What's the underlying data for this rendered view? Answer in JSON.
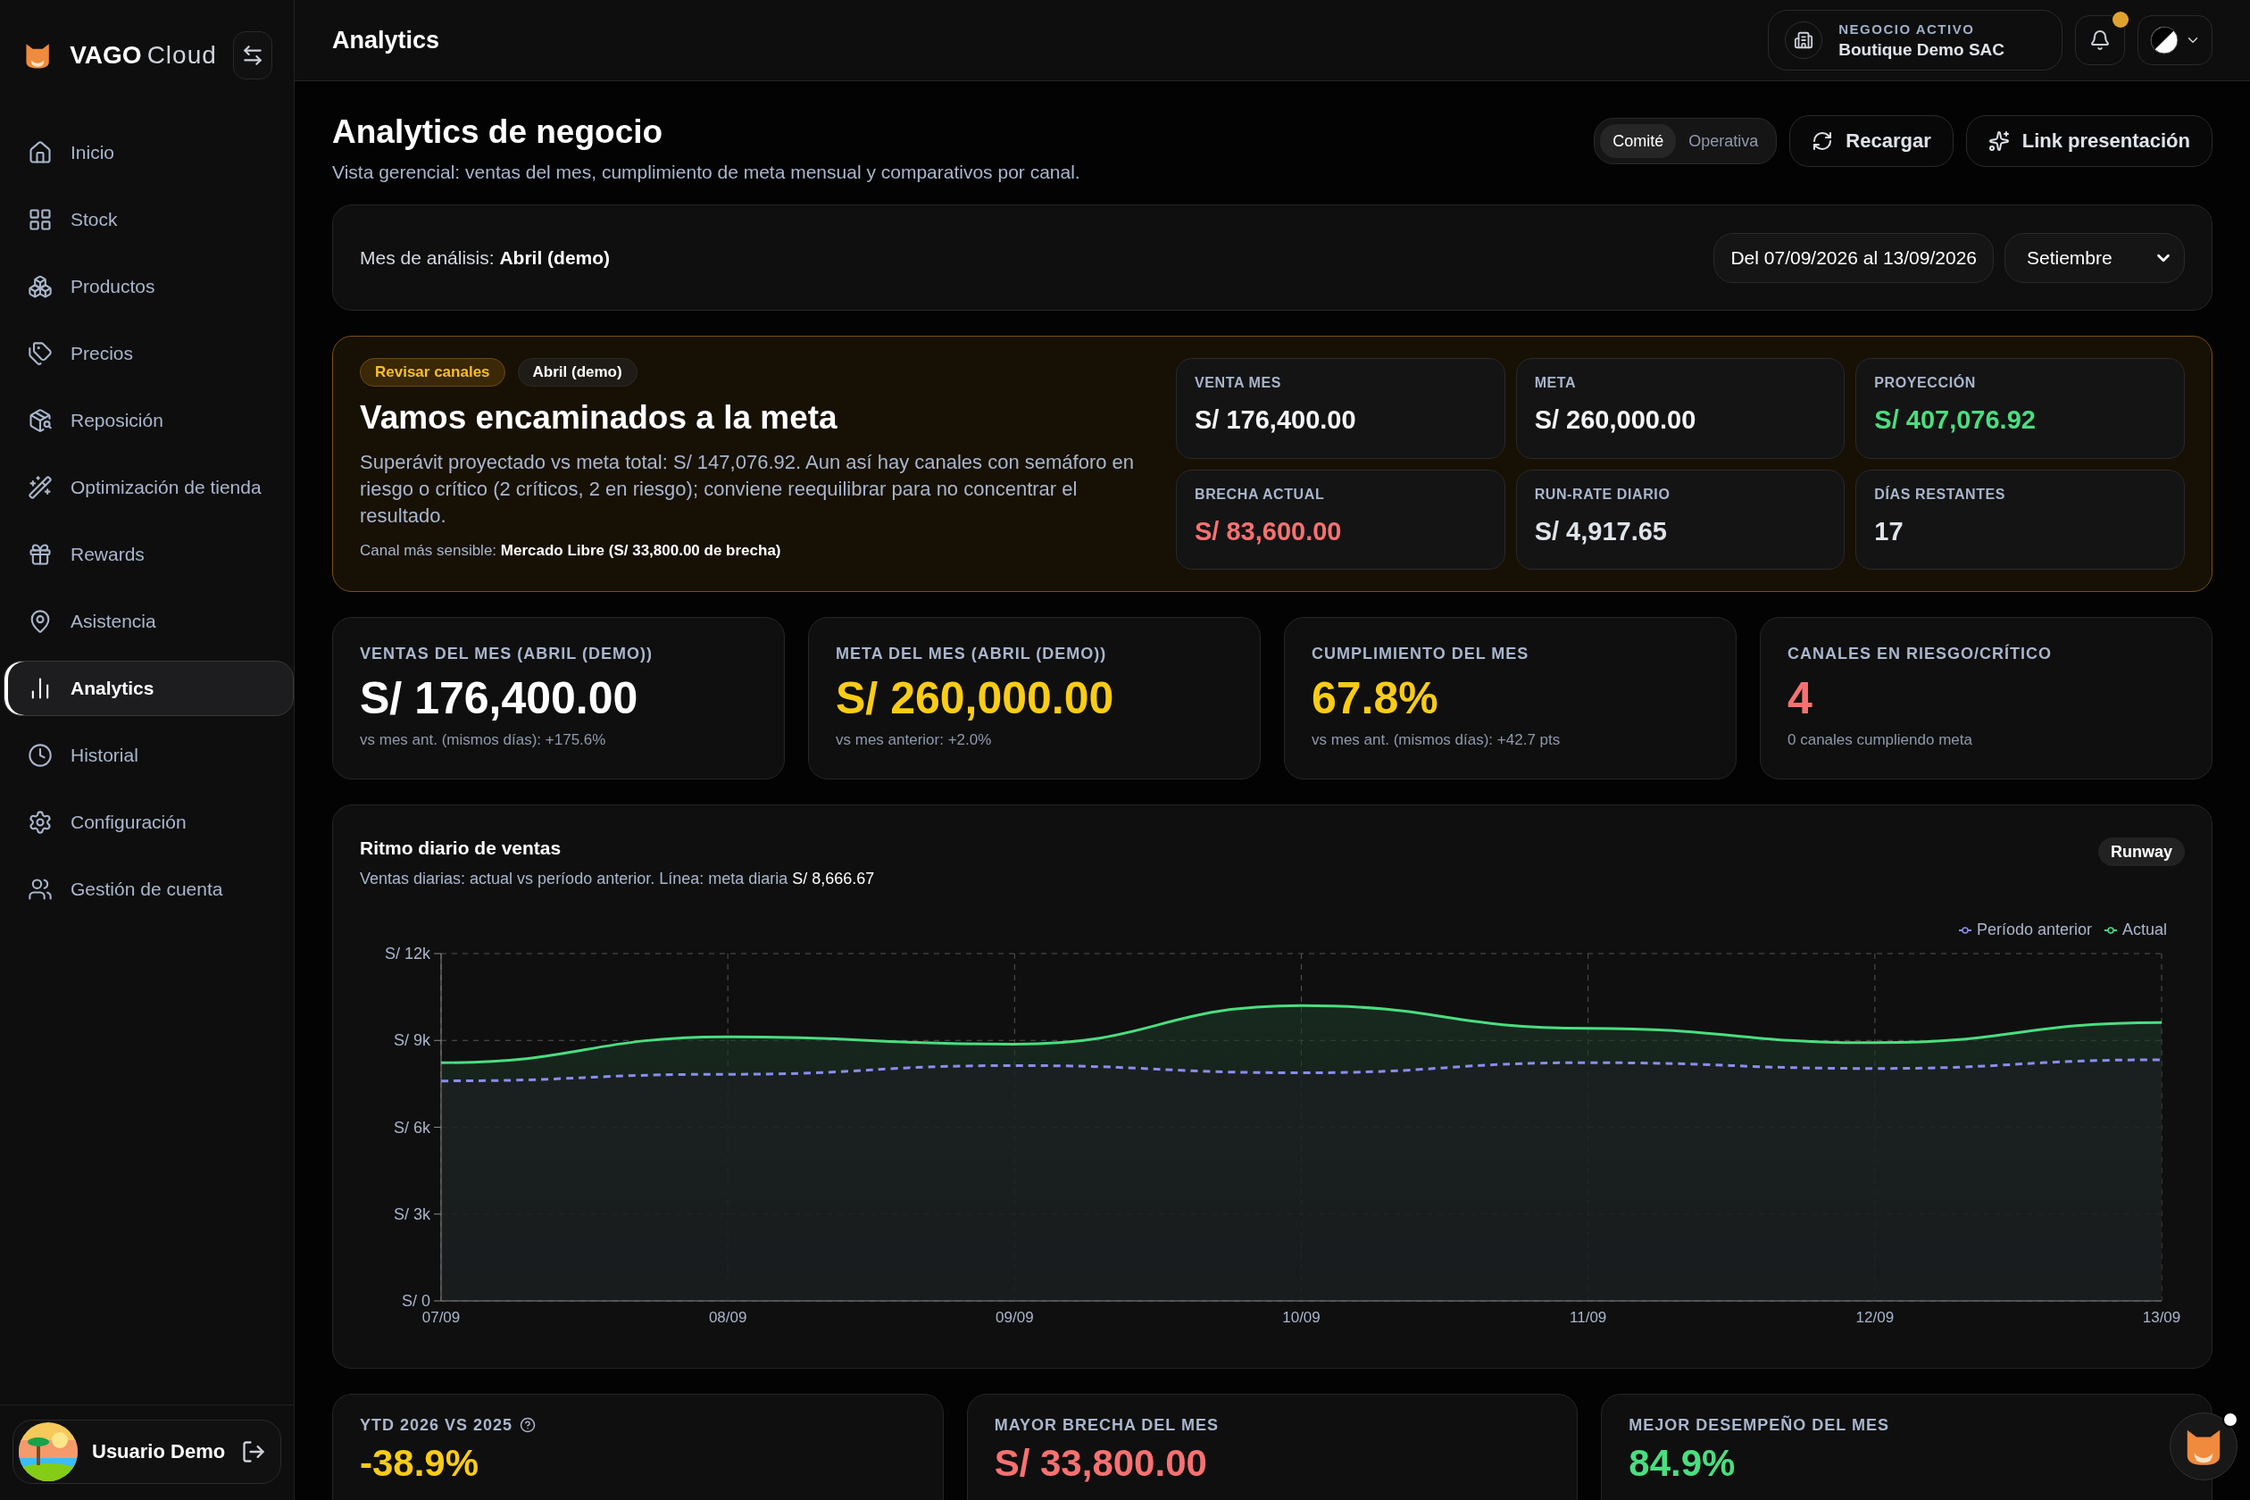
{
  "sidebar": {
    "brand": {
      "strong": "VAGO",
      "light": "Cloud"
    },
    "items": [
      {
        "label": "Inicio",
        "selected": false
      },
      {
        "label": "Stock",
        "selected": false
      },
      {
        "label": "Productos",
        "selected": false
      },
      {
        "label": "Precios",
        "selected": false
      },
      {
        "label": "Reposición",
        "selected": false
      },
      {
        "label": "Optimización de tienda",
        "selected": false
      },
      {
        "label": "Rewards",
        "selected": false
      },
      {
        "label": "Asistencia",
        "selected": false
      },
      {
        "label": "Analytics",
        "selected": true
      },
      {
        "label": "Historial",
        "selected": false
      },
      {
        "label": "Configuración",
        "selected": false
      },
      {
        "label": "Gestión de cuenta",
        "selected": false
      }
    ],
    "user": {
      "name": "Usuario Demo"
    }
  },
  "header": {
    "title": "Analytics",
    "business": {
      "label": "NEGOCIO ACTIVO",
      "name": "Boutique Demo SAC"
    },
    "notifications": {
      "unread": true
    }
  },
  "page": {
    "title": "Analytics de negocio",
    "subtitle": "Vista gerencial: ventas del mes, cumplimiento de meta mensual y comparativos por canal.",
    "modes": [
      {
        "label": "Comité",
        "selected": true
      },
      {
        "label": "Operativa",
        "selected": false
      }
    ],
    "actions": [
      "Recargar",
      "Link presentación"
    ]
  },
  "month_bar": {
    "label": "Mes de análisis: **Abril (demo)**",
    "range": "Del 07/09/2026 al 13/09/2026",
    "month": "Setiembre"
  },
  "banner": {
    "tags": [
      {
        "label": "Revisar canales",
        "kind": "warning"
      },
      {
        "label": "Abril (demo)",
        "kind": "neutral"
      }
    ],
    "title": "Vamos encaminados a la meta",
    "body": "Superávit proyectado vs meta total: S/ 147,076.92. Aun así hay canales con semáforo en riesgo o crítico (2 críticos, 2 en riesgo); conviene reequilibrar para no concentrar el resultado.",
    "note": "Canal más sensible: **Mercado Libre (S/ 33,800.00 de brecha)**",
    "tiles": [
      {
        "label": "VENTA MES",
        "value": "S/ 176,400.00",
        "color": "#f4f5f7"
      },
      {
        "label": "META",
        "value": "S/ 260,000.00",
        "color": "#f4f5f7"
      },
      {
        "label": "PROYECCIÓN",
        "value": "S/ 407,076.92",
        "color": "#4ade80"
      },
      {
        "label": "BRECHA ACTUAL",
        "value": "S/ 83,600.00",
        "color": "#f87171"
      },
      {
        "label": "RUN-RATE DIARIO",
        "value": "S/ 4,917.65",
        "color": "#dfe3ea"
      },
      {
        "label": "DÍAS RESTANTES",
        "value": "17",
        "color": "#dfe3ea"
      }
    ]
  },
  "kpis": [
    {
      "label": "VENTAS DEL MES (ABRIL (DEMO))",
      "value": "S/ 176,400.00",
      "note": "vs mes ant. (mismos días): +175.6%",
      "color": "#ffffff"
    },
    {
      "label": "META DEL MES (ABRIL (DEMO))",
      "value": "S/ 260,000.00",
      "note": "vs mes anterior: +2.0%",
      "color": "#facc15"
    },
    {
      "label": "CUMPLIMIENTO DEL MES",
      "value": "67.8%",
      "note": "vs mes ant. (mismos días): +42.7 pts",
      "color": "#facc15"
    },
    {
      "label": "CANALES EN RIESGO/CRÍTICO",
      "value": "4",
      "note": "0 canales cumpliendo meta",
      "color": "#f87171"
    }
  ],
  "chart": {
    "title": "Ritmo diario de ventas",
    "subtitle": "Ventas diarias: actual vs período anterior. Línea: meta diaria **S/ 8,666.67**",
    "badge": "Runway",
    "chart_data": {
      "type": "area",
      "categories": [
        "07/09",
        "08/09",
        "09/09",
        "10/09",
        "11/09",
        "12/09",
        "13/09"
      ],
      "ylim": [
        0,
        12000
      ],
      "grid": true,
      "yticks": [
        {
          "value": 0,
          "label": "S/ 0"
        },
        {
          "value": 3000,
          "label": "S/ 3k"
        },
        {
          "value": 6000,
          "label": "S/ 6k"
        },
        {
          "value": 9000,
          "label": "S/ 9k"
        },
        {
          "value": 12000,
          "label": "S/ 12k"
        }
      ],
      "series": [
        {
          "name": "Período anterior",
          "color": "#8b8cf0",
          "values": [
            7600,
            7830,
            8130,
            7880,
            8230,
            8030,
            8330
          ]
        },
        {
          "name": "Actual",
          "color": "#4ade80",
          "values": [
            8230,
            9120,
            8870,
            10200,
            9420,
            8920,
            9620
          ]
        }
      ]
    }
  },
  "bottom_cards": [
    {
      "label": "YTD 2026 VS 2025",
      "help": true,
      "value": "-38.9%",
      "color": "#facc15"
    },
    {
      "label": "MAYOR BRECHA DEL MES",
      "help": false,
      "value": "S/ 33,800.00",
      "color": "#f87171"
    },
    {
      "label": "MEJOR DESEMPEÑO DEL MES",
      "help": false,
      "value": "84.9%",
      "color": "#4ade80"
    }
  ]
}
